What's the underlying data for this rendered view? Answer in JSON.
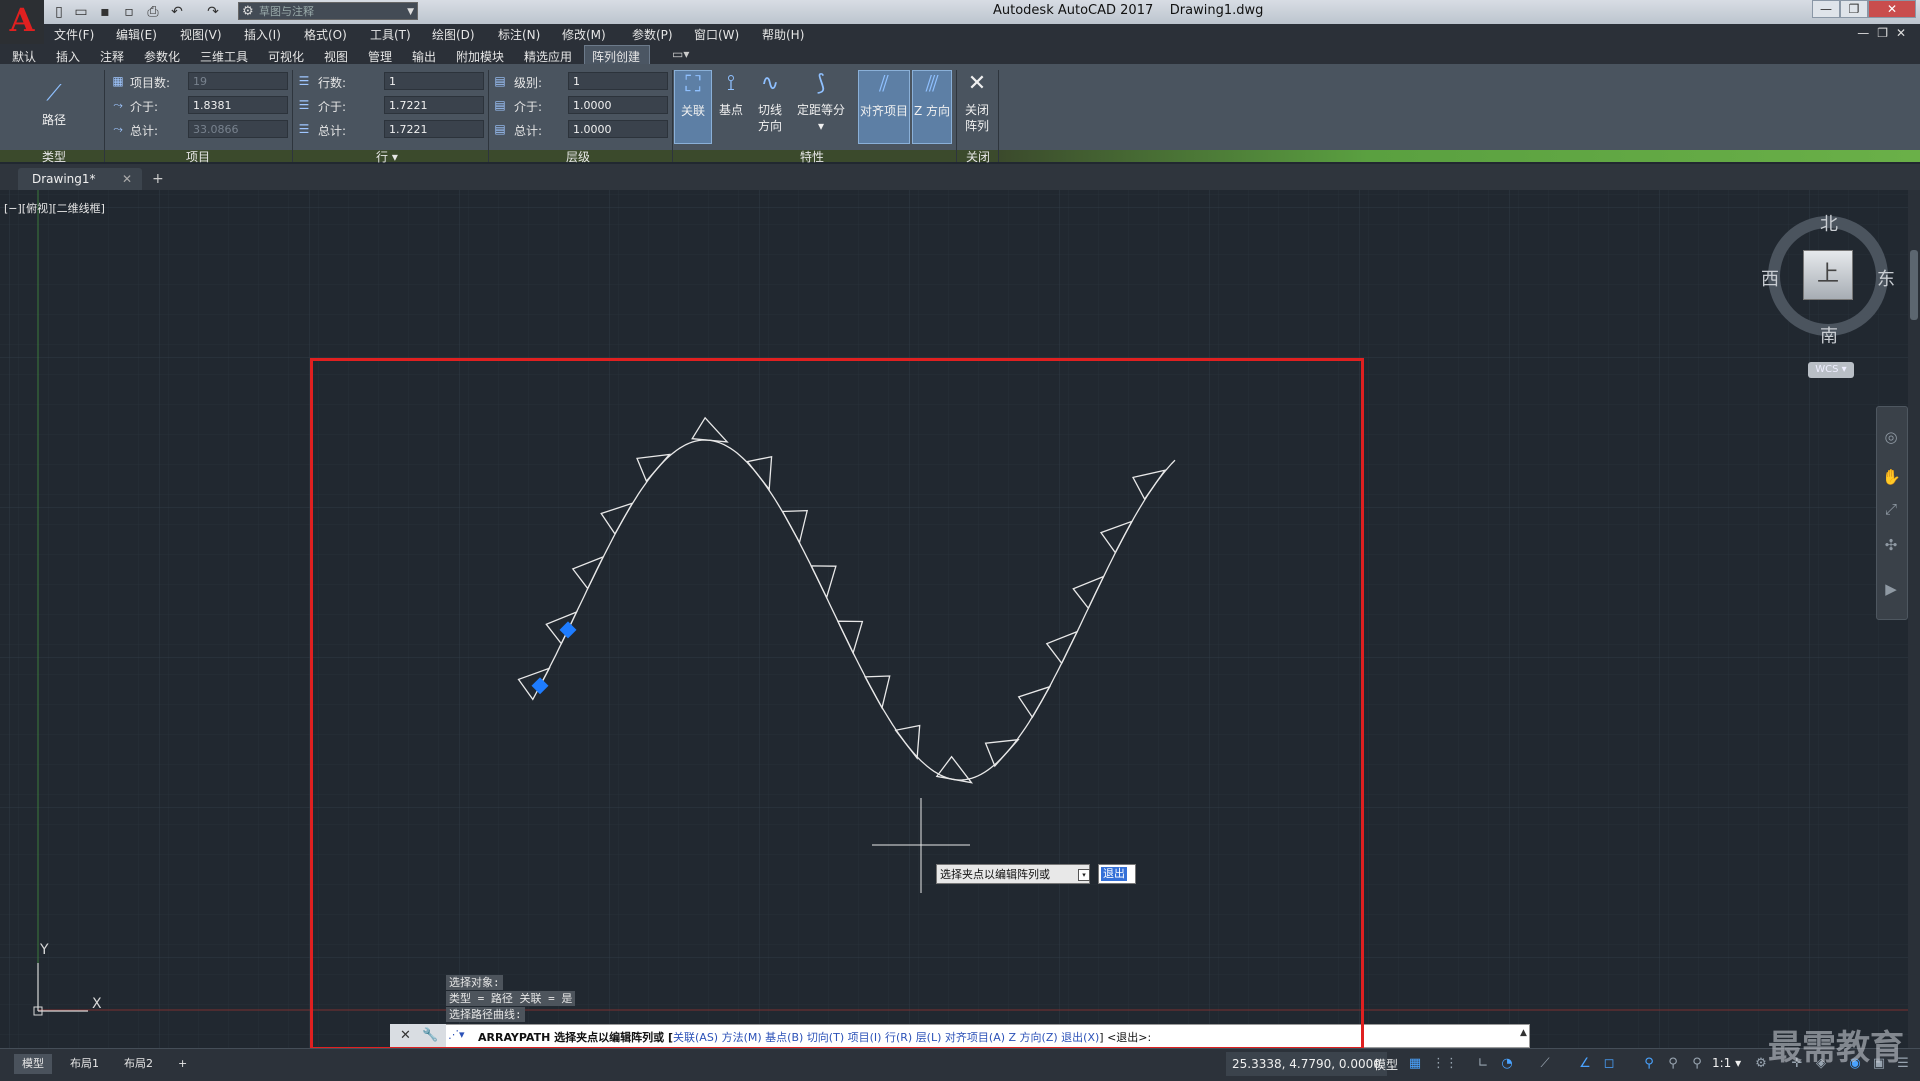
{
  "window": {
    "app_title": "Autodesk AutoCAD 2017",
    "doc_name": "Drawing1.dwg",
    "app_button_letter": "A",
    "workspace": "草图与注释",
    "controls": [
      "—",
      "❐",
      "✕"
    ]
  },
  "menu": [
    "文件(F)",
    "编辑(E)",
    "视图(V)",
    "插入(I)",
    "格式(O)",
    "工具(T)",
    "绘图(D)",
    "标注(N)",
    "修改(M)",
    "参数(P)",
    "窗口(W)",
    "帮助(H)"
  ],
  "ribbon_tabs": [
    "默认",
    "插入",
    "注释",
    "参数化",
    "三维工具",
    "可视化",
    "视图",
    "管理",
    "输出",
    "附加模块",
    "精选应用",
    "阵列创建"
  ],
  "ribbon": {
    "type_panel": {
      "title": "类型",
      "button": "路径"
    },
    "items_panel": {
      "title": "项目",
      "rows": [
        {
          "label": "项目数:",
          "value": "19"
        },
        {
          "label": "介于:",
          "value": "1.8381"
        },
        {
          "label": "总计:",
          "value": "33.0866"
        }
      ]
    },
    "rows_panel": {
      "title": "行 ▾",
      "rows": [
        {
          "label": "行数:",
          "value": "1"
        },
        {
          "label": "介于:",
          "value": "1.7221"
        },
        {
          "label": "总计:",
          "value": "1.7221"
        }
      ]
    },
    "levels_panel": {
      "title": "层级",
      "rows": [
        {
          "label": "级别:",
          "value": "1"
        },
        {
          "label": "介于:",
          "value": "1.0000"
        },
        {
          "label": "总计:",
          "value": "1.0000"
        }
      ]
    },
    "props_panel": {
      "title": "特性",
      "buttons": [
        {
          "label": "关联",
          "line2": ""
        },
        {
          "label": "基点",
          "line2": ""
        },
        {
          "label": "切线",
          "line2": "方向"
        },
        {
          "label": "定距等分",
          "line2": "▾"
        },
        {
          "label": "对齐项目",
          "line2": ""
        },
        {
          "label": "Z 方向",
          "line2": ""
        }
      ]
    },
    "close_panel": {
      "title": "关闭",
      "label": "关闭",
      "line2": "阵列"
    }
  },
  "file_tab": {
    "name": "Drawing1*",
    "close": "✕",
    "new": "+"
  },
  "viewport": {
    "label": "[−][俯视][二维线框]"
  },
  "viewcube": {
    "north": "北",
    "south": "南",
    "west": "西",
    "east": "东",
    "face": "上",
    "wcs": "WCS ▾"
  },
  "ucs": {
    "x": "X",
    "y": "Y"
  },
  "drawing": {
    "triangle_count": 19,
    "grip_color": "#1e7cff",
    "line_color": "#e8e8e8"
  },
  "tooltip": {
    "prompt": "选择夹点以编辑阵列或",
    "dropdown": "▾",
    "default": "退出"
  },
  "history": [
    "选择对象:",
    "类型 = 路径  关联 = 是",
    "选择路径曲线:"
  ],
  "command": {
    "prefix": "ARRAYPATH 选择夹点以编辑阵列或 [",
    "options": [
      "关联(AS)",
      "方法(M)",
      "基点(B)",
      "切向(T)",
      "项目(I)",
      "行(R)",
      "层(L)",
      "对齐项目(A)",
      "Z 方向(Z)",
      "退出(X)"
    ],
    "suffix": "] <退出>:",
    "end_arrow": "▲"
  },
  "status": {
    "layout_tabs": [
      "模型",
      "布局1",
      "布局2",
      "+"
    ],
    "coords": "25.3338, 4.7790, 0.0000",
    "mode": "模型",
    "scale": "1:1 ▾"
  },
  "watermark": "最需教育",
  "colors": {
    "accent_red": "#e02020",
    "ribbon_green": "#6ab048",
    "bg": "#212830"
  }
}
